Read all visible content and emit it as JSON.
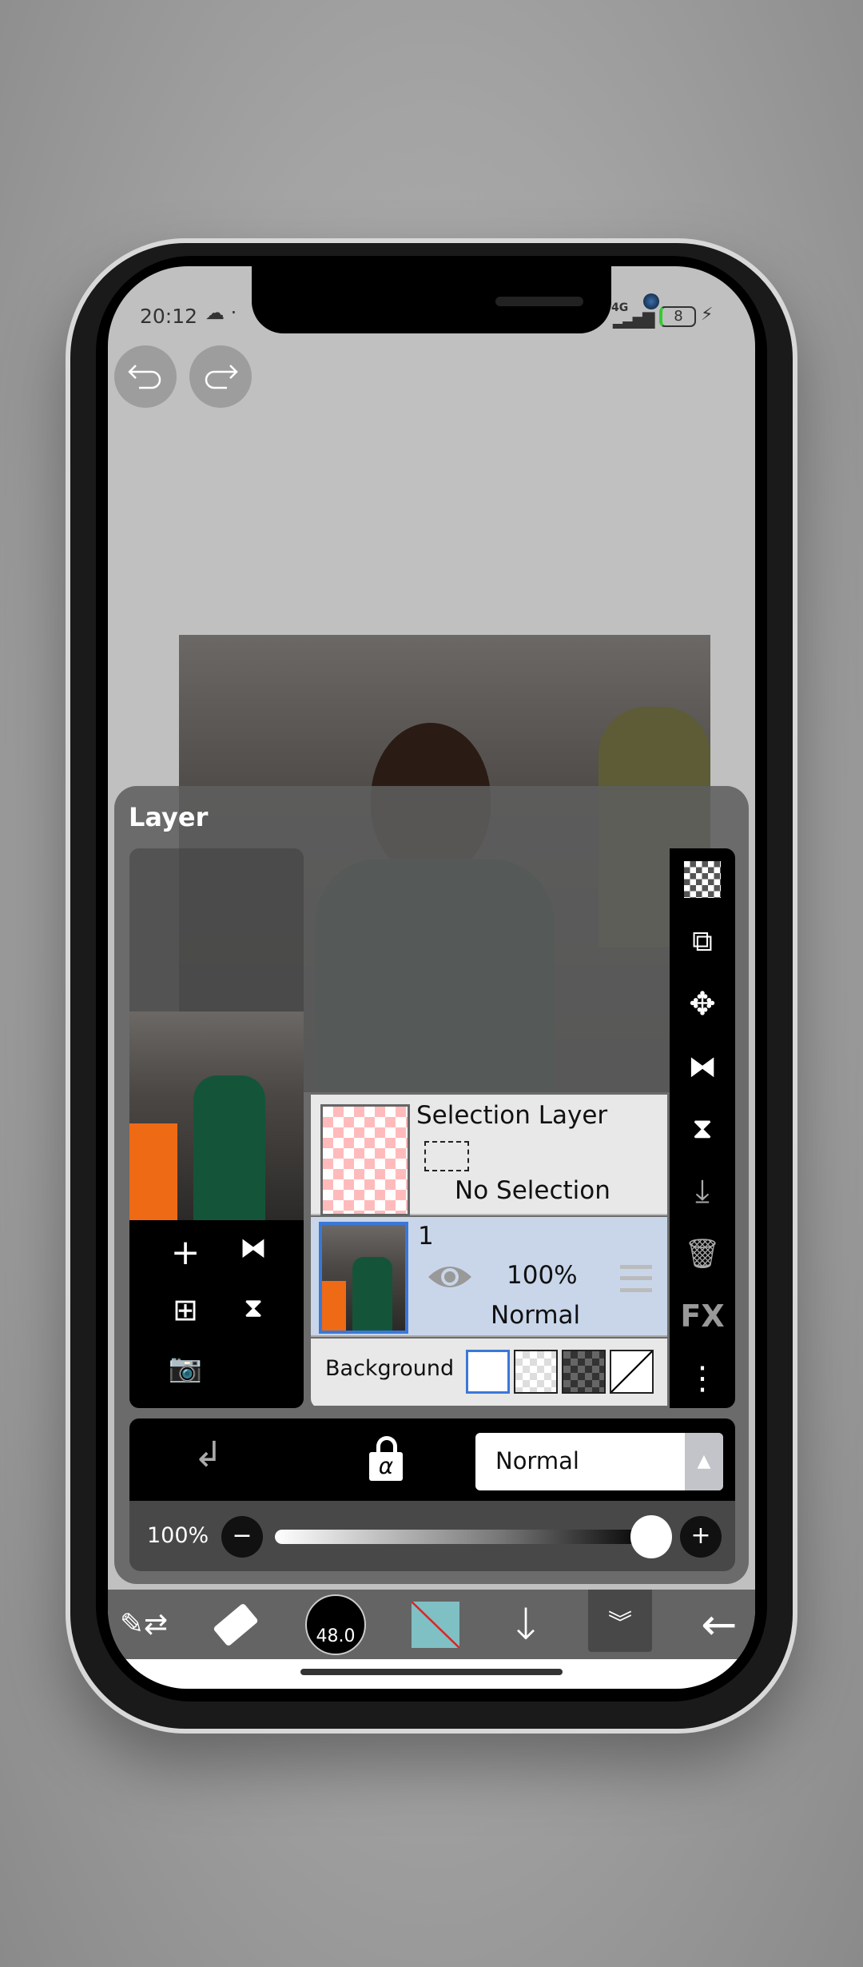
{
  "status_bar": {
    "time": "20:12",
    "network": "4G",
    "battery": "8"
  },
  "panel": {
    "title": "Layer",
    "selection_layer": {
      "name": "Selection Layer",
      "status": "No Selection"
    },
    "layers": [
      {
        "name": "1",
        "opacity": "100%",
        "blend": "Normal",
        "visible": true,
        "selected": true
      }
    ],
    "background_label": "Background",
    "blend_mode": "Normal",
    "opacity_label": "100%",
    "opacity_value": 100,
    "right_tools": [
      "checker-icon",
      "copy-swap-icon",
      "move-icon",
      "flip-horizontal-icon",
      "flip-vertical-icon",
      "merge-down-icon",
      "trash-icon",
      "fx-icon",
      "more-icon"
    ],
    "fx_label": "FX"
  },
  "toolbar": {
    "brush_size": "48.0",
    "colors": {
      "primary": "#7fc0c4",
      "accent": "#3f78d8"
    }
  }
}
